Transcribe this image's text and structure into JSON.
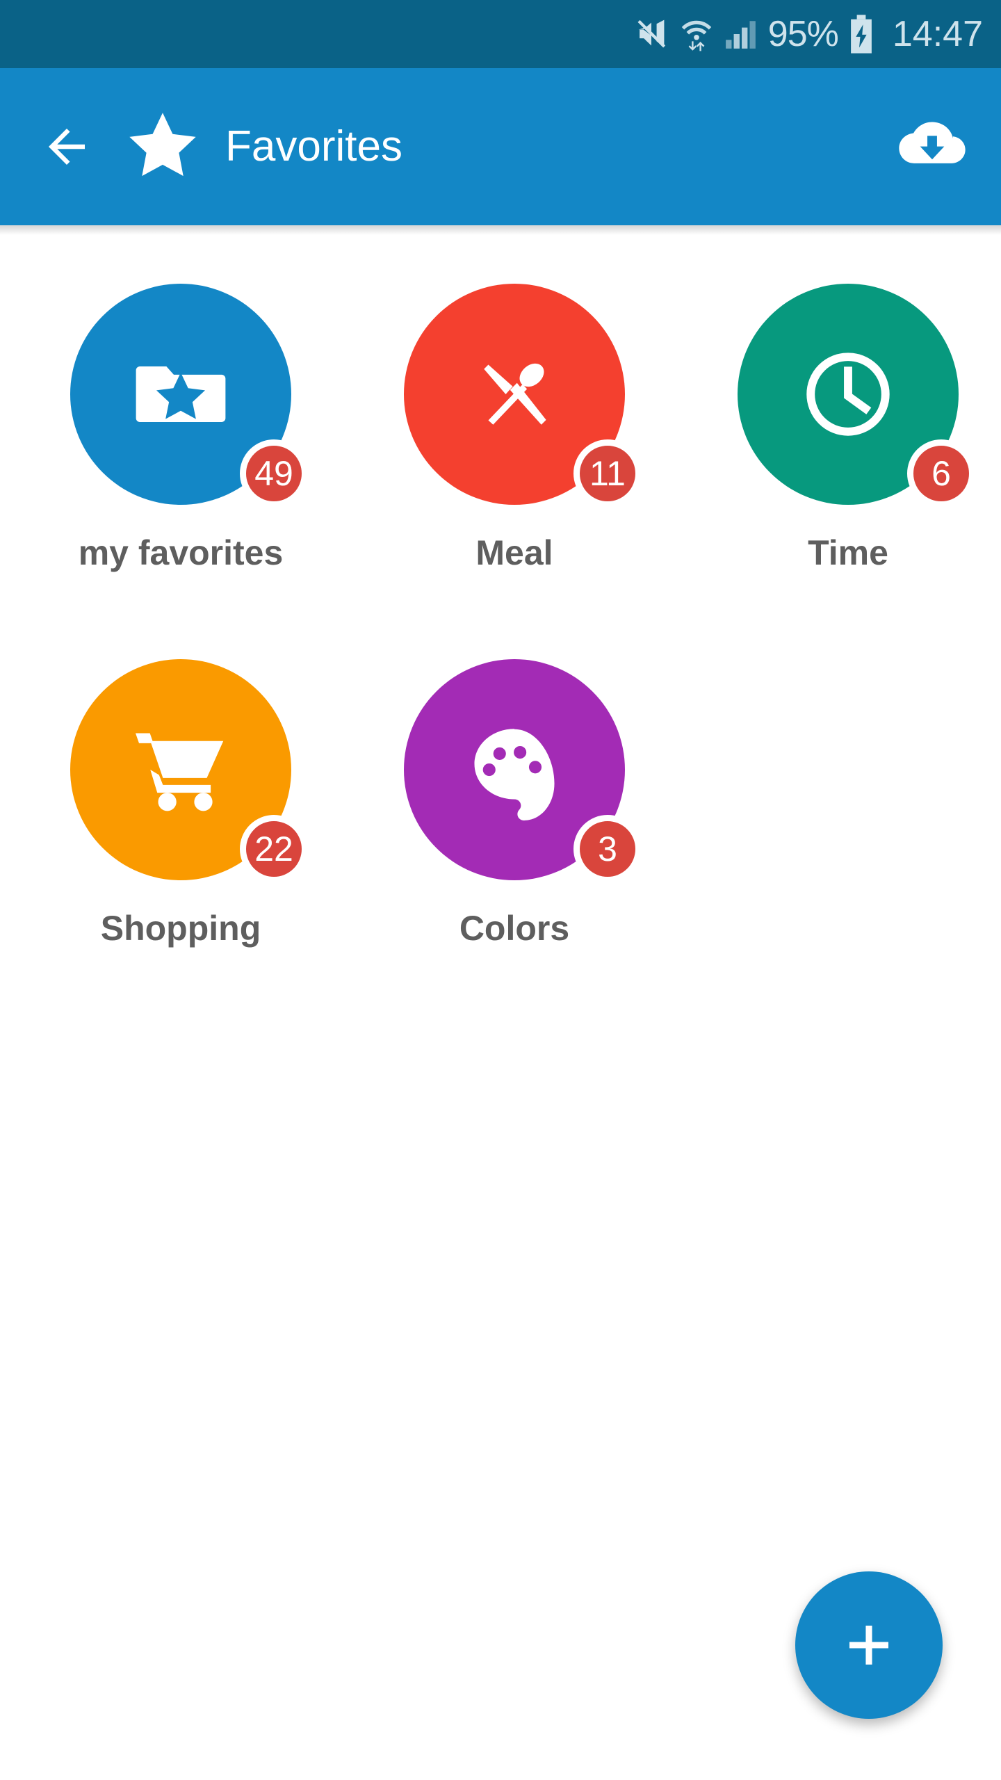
{
  "status_bar": {
    "background": "#0a6287",
    "mute_icon": "mute-icon",
    "wifi_icon": "wifi-transfer-icon",
    "signal_icon": "cellular-signal-icon",
    "battery_percent": "95%",
    "battery_icon": "battery-charging-icon",
    "time": "14:47"
  },
  "app_bar": {
    "background": "#1387c6",
    "back_icon": "back-arrow-icon",
    "star_icon": "star-icon",
    "title": "Favorites",
    "action_icon": "cloud-download-icon"
  },
  "content": {
    "background": "#ffffff",
    "categories": [
      {
        "label": "my favorites",
        "badge": "49",
        "color": "#1387c6",
        "icon": "folder-star-icon"
      },
      {
        "label": "Meal",
        "badge": "11",
        "color": "#f4402f",
        "icon": "cutlery-icon"
      },
      {
        "label": "Time",
        "badge": "6",
        "color": "#07997e",
        "icon": "clock-icon"
      },
      {
        "label": "Shopping",
        "badge": "22",
        "color": "#fa9a00",
        "icon": "shopping-cart-icon"
      },
      {
        "label": "Colors",
        "badge": "3",
        "color": "#a32bb5",
        "icon": "palette-icon"
      }
    ],
    "badge_color": "#d9453c",
    "label_color": "#5e5e5e"
  },
  "fab": {
    "icon": "plus-icon",
    "color": "#1387c6"
  }
}
